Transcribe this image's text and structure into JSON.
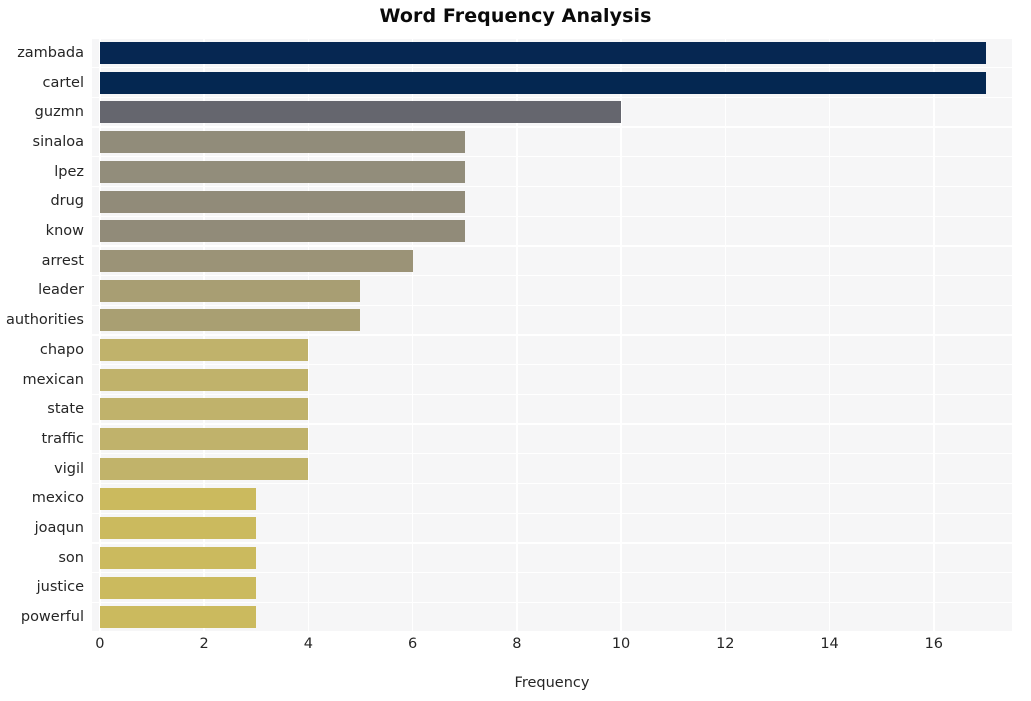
{
  "chart_data": {
    "type": "bar",
    "orientation": "horizontal",
    "title": "Word Frequency Analysis",
    "xlabel": "Frequency",
    "ylabel": "",
    "categories": [
      "zambada",
      "cartel",
      "guzmn",
      "sinaloa",
      "lpez",
      "drug",
      "know",
      "arrest",
      "leader",
      "authorities",
      "chapo",
      "mexican",
      "state",
      "traffic",
      "vigil",
      "mexico",
      "joaqun",
      "son",
      "justice",
      "powerful"
    ],
    "values": [
      17,
      17,
      10,
      7,
      7,
      7,
      7,
      6,
      5,
      5,
      4,
      4,
      4,
      4,
      4,
      3,
      3,
      3,
      3,
      3
    ],
    "bar_colors": [
      "#062752",
      "#042751",
      "#65666e",
      "#918c7a",
      "#928d7b",
      "#918b79",
      "#918b79",
      "#9b9377",
      "#a89e73",
      "#a99f72",
      "#c0b26b",
      "#c0b26b",
      "#c0b26b",
      "#c0b26b",
      "#c1b36a",
      "#cbba5e",
      "#cbba5e",
      "#cbba5e",
      "#cbba5e",
      "#cbba5e"
    ],
    "xticks": [
      0,
      2,
      4,
      6,
      8,
      10,
      12,
      14,
      16
    ],
    "xlim": [
      -0.15,
      17.5
    ],
    "grid": true,
    "grid_color": "#ffffff",
    "plot_background": "#f6f6f7",
    "figure_background": "#ffffff",
    "legend": null
  }
}
